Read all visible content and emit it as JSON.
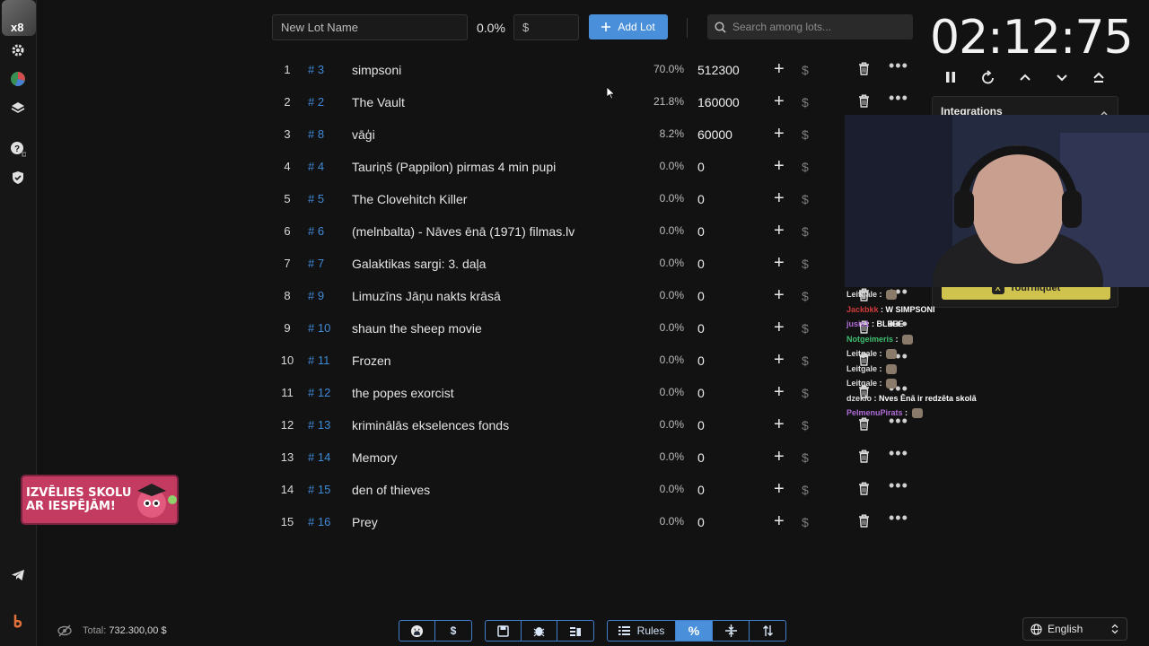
{
  "sidebar": {
    "avatar_badge": "x8",
    "icons": [
      "settings-icon",
      "pie-chart-icon",
      "layers-icon",
      "help-icon",
      "shield-icon",
      "telegram-icon",
      "brand-icon"
    ]
  },
  "toolbar": {
    "lot_name_placeholder": "New Lot Name",
    "percent": "0.0%",
    "amount_placeholder": "$",
    "add_lot_label": "Add Lot",
    "search_placeholder": "Search among lots..."
  },
  "lots": [
    {
      "num": "1",
      "id": "# 3",
      "name": "simpsoni",
      "pct": "70.0%",
      "amount": "512300",
      "trash": true
    },
    {
      "num": "2",
      "id": "# 2",
      "name": "The Vault",
      "pct": "21.8%",
      "amount": "160000",
      "trash": true
    },
    {
      "num": "3",
      "id": "# 8",
      "name": "vāģi",
      "pct": "8.2%",
      "amount": "60000",
      "trash": false
    },
    {
      "num": "4",
      "id": "# 4",
      "name": "Tauriņš (Pappilon) pirmas 4 min pupi",
      "pct": "0.0%",
      "amount": "0",
      "trash": false
    },
    {
      "num": "5",
      "id": "# 5",
      "name": "The Clovehitch Killer",
      "pct": "0.0%",
      "amount": "0",
      "trash": false
    },
    {
      "num": "6",
      "id": "# 6",
      "name": "(melnbalta) - Nāves ēnā (1971) filmas.lv",
      "pct": "0.0%",
      "amount": "0",
      "trash": false
    },
    {
      "num": "7",
      "id": "# 7",
      "name": "Galaktikas sargi: 3. daļa",
      "pct": "0.0%",
      "amount": "0",
      "trash": false
    },
    {
      "num": "8",
      "id": "# 9",
      "name": "Limuzīns Jāņu nakts krāsā",
      "pct": "0.0%",
      "amount": "0",
      "trash": true
    },
    {
      "num": "9",
      "id": "# 10",
      "name": "shaun the sheep movie",
      "pct": "0.0%",
      "amount": "0",
      "trash": true
    },
    {
      "num": "10",
      "id": "# 11",
      "name": "Frozen",
      "pct": "0.0%",
      "amount": "0",
      "trash": true
    },
    {
      "num": "11",
      "id": "# 12",
      "name": "the popes exorcist",
      "pct": "0.0%",
      "amount": "0",
      "trash": true
    },
    {
      "num": "12",
      "id": "# 13",
      "name": "kriminālās ekselences fonds",
      "pct": "0.0%",
      "amount": "0",
      "trash": true
    },
    {
      "num": "13",
      "id": "# 14",
      "name": "Memory",
      "pct": "0.0%",
      "amount": "0",
      "trash": true
    },
    {
      "num": "14",
      "id": "# 15",
      "name": "den of thieves",
      "pct": "0.0%",
      "amount": "0",
      "trash": true
    },
    {
      "num": "15",
      "id": "# 16",
      "name": "Prey",
      "pct": "0.0%",
      "amount": "0",
      "trash": true
    }
  ],
  "timer": {
    "display": "02:12:75"
  },
  "integrations": {
    "title": "Integrations",
    "tourney_label": "Tourniquet"
  },
  "chat": [
    {
      "user": "Leitgale",
      "msg": "",
      "color": "#dcdcdc"
    },
    {
      "user": "Jackbkk",
      "msg": "W SIMPSONI",
      "color": "#d03a3a"
    },
    {
      "user": "jusis1",
      "msg": "BLEEE",
      "color": "#b06bd8"
    },
    {
      "user": "Notgeimeris",
      "msg": "",
      "color": "#3fbf6f"
    },
    {
      "user": "Leitgale",
      "msg": "",
      "color": "#dcdcdc"
    },
    {
      "user": "Leitgale",
      "msg": "",
      "color": "#dcdcdc"
    },
    {
      "user": "Leitgale",
      "msg": "",
      "color": "#dcdcdc"
    },
    {
      "user": "dzeklo",
      "msg": "Nves Ēnā ir redzēta skolā",
      "color": "#dcdcdc"
    },
    {
      "user": "PelmenuPirats",
      "msg": "",
      "color": "#b06bd8"
    }
  ],
  "promo": {
    "line1": "IZVĒLIES SKOLU",
    "line2": "AR IESPĒJĀM!"
  },
  "footer": {
    "total_label": "Total:",
    "total_value": "732.300,00 $",
    "rules_label": "Rules",
    "language": "English"
  },
  "colors": {
    "accent": "#4a8fd9",
    "id_link": "#3f8ad6",
    "background": "#121212"
  }
}
